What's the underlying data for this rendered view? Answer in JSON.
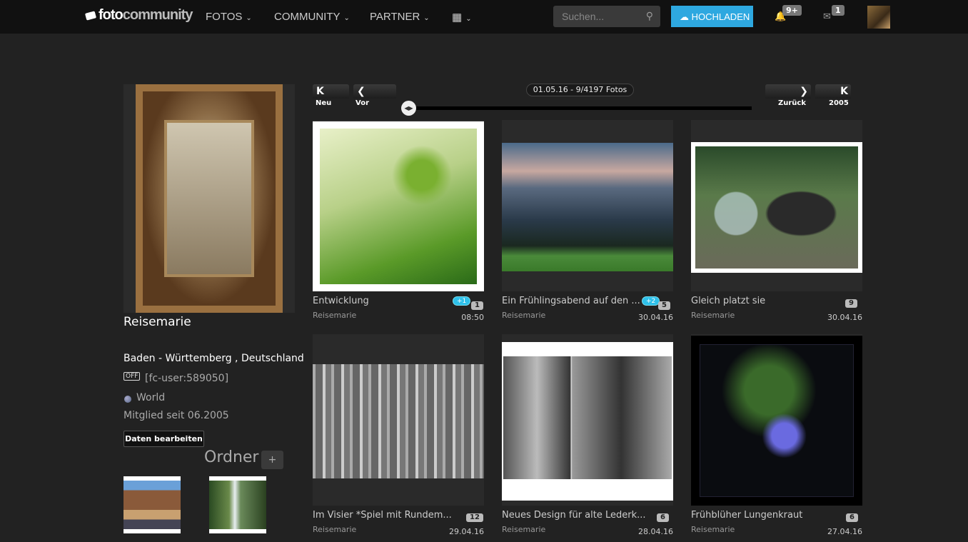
{
  "nav": {
    "logo_a": "foto",
    "logo_b": "community",
    "menu": [
      "FOTOS",
      "COMMUNITY",
      "PARTNER"
    ],
    "search_placeholder": "Suchen...",
    "upload": "HOCHLADEN",
    "notifications": "9+",
    "messages": "1",
    "accent": "#2ea8e0"
  },
  "profile": {
    "name": "Reisemarie",
    "location": "Baden - Württemberg , Deutschland",
    "status": "OFF",
    "user_id": "[fc-user:589050]",
    "world": "World",
    "member_since": "Mitglied seit 06.2005",
    "edit": "Daten bearbeiten",
    "folders_title": "Ordner",
    "add": "+"
  },
  "pager": {
    "first": "Neu",
    "prev": "Vor",
    "next": "Zurück",
    "last": "2005",
    "info": "01.05.16 - 9/4197 Fotos"
  },
  "photos": [
    {
      "title": "Entwicklung",
      "user": "Reisemarie",
      "date": "08:50",
      "comments": "1",
      "new": "+1"
    },
    {
      "title": "Ein Frühlingsabend auf den ...",
      "user": "Reisemarie",
      "date": "30.04.16",
      "comments": "5",
      "new": "+2"
    },
    {
      "title": "Gleich platzt sie",
      "user": "Reisemarie",
      "date": "30.04.16",
      "comments": "9"
    },
    {
      "title": "Im Visier *Spiel mit Rundem...",
      "user": "Reisemarie",
      "date": "29.04.16",
      "comments": "12"
    },
    {
      "title": "Neues Design für alte Lederk...",
      "user": "Reisemarie",
      "date": "28.04.16",
      "comments": "6"
    },
    {
      "title": "Frühblüher Lungenkraut",
      "user": "Reisemarie",
      "date": "27.04.16",
      "comments": "6"
    }
  ]
}
